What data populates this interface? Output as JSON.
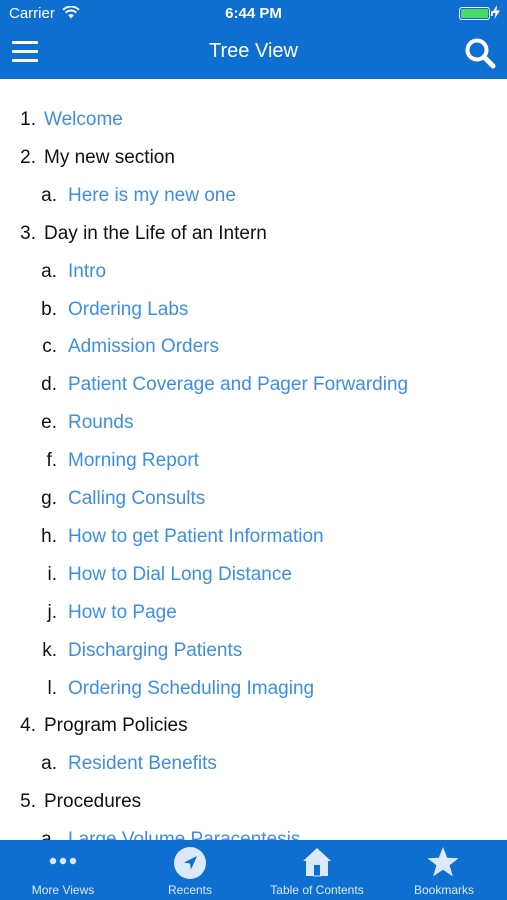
{
  "status_bar": {
    "carrier": "Carrier",
    "time": "6:44 PM"
  },
  "nav": {
    "title": "Tree View"
  },
  "tree": [
    {
      "marker": "1.",
      "label": "Welcome",
      "level": 1,
      "link": true
    },
    {
      "marker": "2.",
      "label": "My new section",
      "level": 1,
      "link": false
    },
    {
      "marker": "a.",
      "label": "Here is my new one",
      "level": 2,
      "link": true
    },
    {
      "marker": "3.",
      "label": "Day in the Life of an Intern",
      "level": 1,
      "link": false
    },
    {
      "marker": "a.",
      "label": "Intro",
      "level": 2,
      "link": true
    },
    {
      "marker": "b.",
      "label": "Ordering Labs",
      "level": 2,
      "link": true
    },
    {
      "marker": "c.",
      "label": "Admission Orders",
      "level": 2,
      "link": true
    },
    {
      "marker": "d.",
      "label": "Patient Coverage and Pager Forwarding",
      "level": 2,
      "link": true
    },
    {
      "marker": "e.",
      "label": "Rounds",
      "level": 2,
      "link": true
    },
    {
      "marker": "f.",
      "label": "Morning Report",
      "level": 2,
      "link": true
    },
    {
      "marker": "g.",
      "label": "Calling Consults",
      "level": 2,
      "link": true
    },
    {
      "marker": "h.",
      "label": "How to get Patient Information",
      "level": 2,
      "link": true
    },
    {
      "marker": "i.",
      "label": "How to Dial Long Distance",
      "level": 2,
      "link": true
    },
    {
      "marker": "j.",
      "label": "How to Page",
      "level": 2,
      "link": true
    },
    {
      "marker": "k.",
      "label": "Discharging Patients",
      "level": 2,
      "link": true
    },
    {
      "marker": "l.",
      "label": "Ordering Scheduling Imaging",
      "level": 2,
      "link": true
    },
    {
      "marker": "4.",
      "label": "Program Policies",
      "level": 1,
      "link": false
    },
    {
      "marker": "a.",
      "label": "Resident Benefits",
      "level": 2,
      "link": true
    },
    {
      "marker": "5.",
      "label": "Procedures",
      "level": 1,
      "link": false
    },
    {
      "marker": "a.",
      "label": "Large Volume Paracentesis",
      "level": 2,
      "link": true
    }
  ],
  "tabbar": {
    "tabs": [
      {
        "label": "More Views",
        "icon": "more-icon"
      },
      {
        "label": "Recents",
        "icon": "location-arrow-icon"
      },
      {
        "label": "Table of Contents",
        "icon": "home-icon"
      },
      {
        "label": "Bookmarks",
        "icon": "star-icon"
      }
    ]
  },
  "colors": {
    "bar": "#0e6fd0",
    "link": "#3d8ee5",
    "text": "#111111",
    "battery": "#4cd964"
  }
}
